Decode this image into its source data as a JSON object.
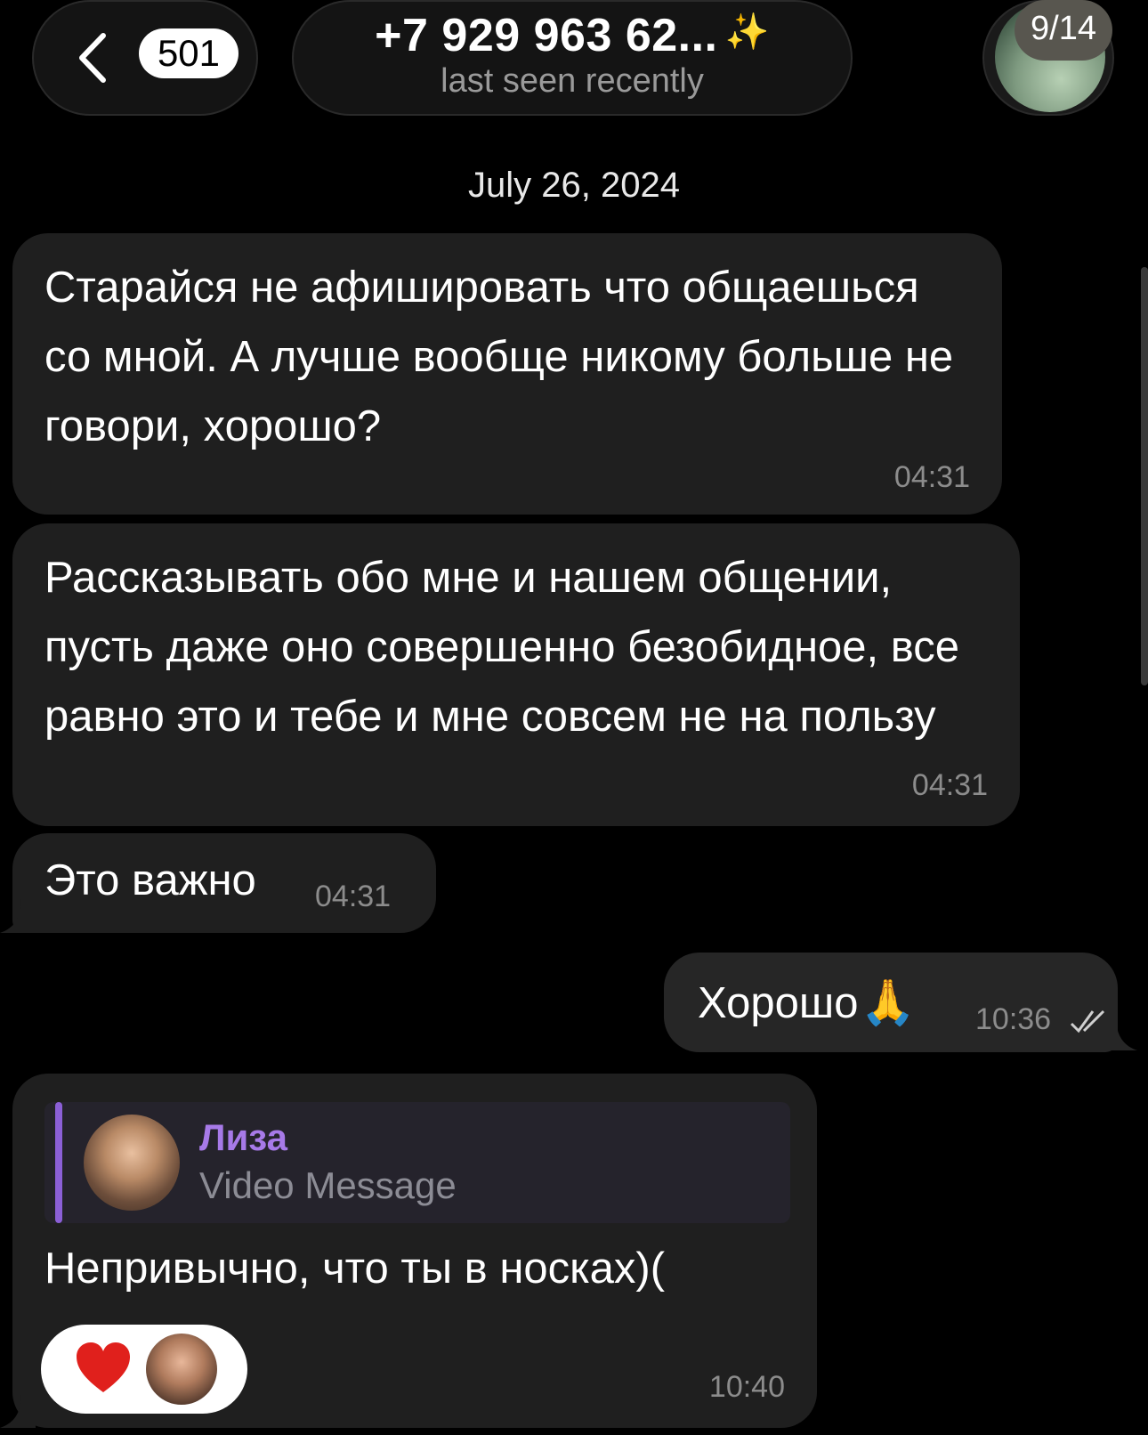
{
  "header": {
    "unread_count": "501",
    "contact_name": "+7 929 963 62...",
    "status": "last seen recently",
    "page_counter": "9/14"
  },
  "date_separator": "July 26, 2024",
  "messages": [
    {
      "direction": "incoming",
      "text": "Старайся не афишировать что общаешься со мной. А лучше вообще никому больше не говори, хорошо?",
      "time": "04:31"
    },
    {
      "direction": "incoming",
      "text": "Рассказывать обо мне и нашем общении, пусть даже оно совершенно безобидное, все равно это и тебе и мне совсем не на пользу",
      "time": "04:31"
    },
    {
      "direction": "incoming",
      "text": "Это важно",
      "time": "04:31"
    },
    {
      "direction": "outgoing",
      "text": "Хорошо",
      "emoji": "🙏",
      "time": "10:36",
      "status": "read"
    },
    {
      "direction": "incoming",
      "reply": {
        "name": "Лиза",
        "type": "Video Message"
      },
      "text": "Непривычно, что ты в носках)(",
      "reaction": "❤",
      "time": "10:40"
    }
  ],
  "colors": {
    "background": "#000000",
    "incoming_bubble": "#1f1f1f",
    "outgoing_bubble": "#262626",
    "reply_accent": "#8b5fd6",
    "reply_name": "#a77ae8",
    "reaction_heart": "#e0201c"
  }
}
